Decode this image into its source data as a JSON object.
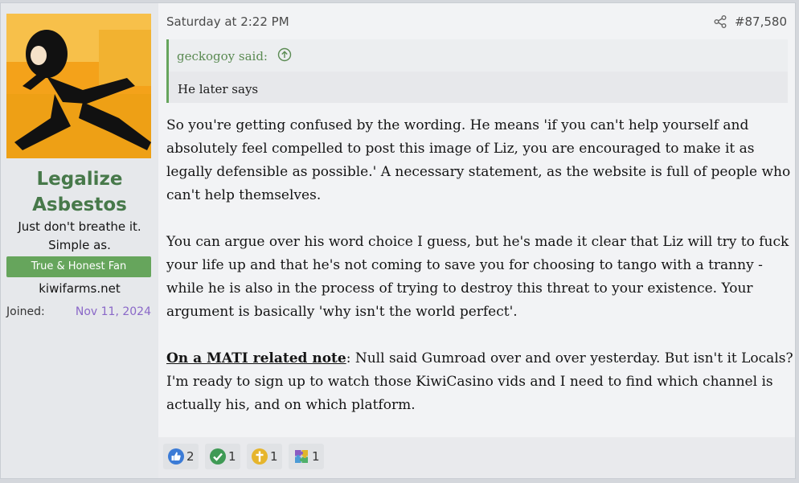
{
  "user": {
    "name_line1": "Legalize",
    "name_line2": "Asbestos",
    "title_line1": "Just don't breathe it.",
    "title_line2": "Simple as.",
    "banner": "True & Honest Fan",
    "site": "kiwifarms.net",
    "joined_label": "Joined:",
    "joined_date": "Nov 11, 2024"
  },
  "post": {
    "date": "Saturday at 2:22 PM",
    "number": "#87,580",
    "quote": {
      "author": "geckogoy said:",
      "text": "He later says"
    },
    "paragraph1": "So you're getting confused by the wording. He means 'if you can't help yourself and absolutely feel compelled to post this image of Liz, you are encouraged to make it as legally defensible as possible.' A necessary statement, as the website is full of people who can't help themselves.",
    "paragraph2": "You can argue over his word choice I guess, but he's made it clear that Liz will try to fuck your life up and that he's not coming to save you for choosing to tango with a tranny - while he is also in the process of trying to destroy this threat to your existence. Your argument is basically 'why isn't the world perfect'.",
    "paragraph3_bold": "On a MATI related note",
    "paragraph3_rest": ": Null said Gumroad over and over yesterday. But isn't it Locals? I'm ready to sign up to watch those KiwiCasino vids and I need to find which channel is actually his, and on which platform."
  },
  "reactions": [
    {
      "icon": "thumbs-up-icon",
      "count": "2",
      "color": "#3b7bd6"
    },
    {
      "icon": "check-mark-icon",
      "count": "1",
      "color": "#3f9a55"
    },
    {
      "icon": "cross-icon",
      "count": "1",
      "color": "#e6b52c"
    },
    {
      "icon": "puzzle-piece-icon",
      "count": "1",
      "color": "#8a5cc2"
    }
  ],
  "colors": {
    "username": "#47794a",
    "banner": "#66a55c",
    "joined_date": "#8a68c8",
    "quote_border": "#66a55c"
  }
}
